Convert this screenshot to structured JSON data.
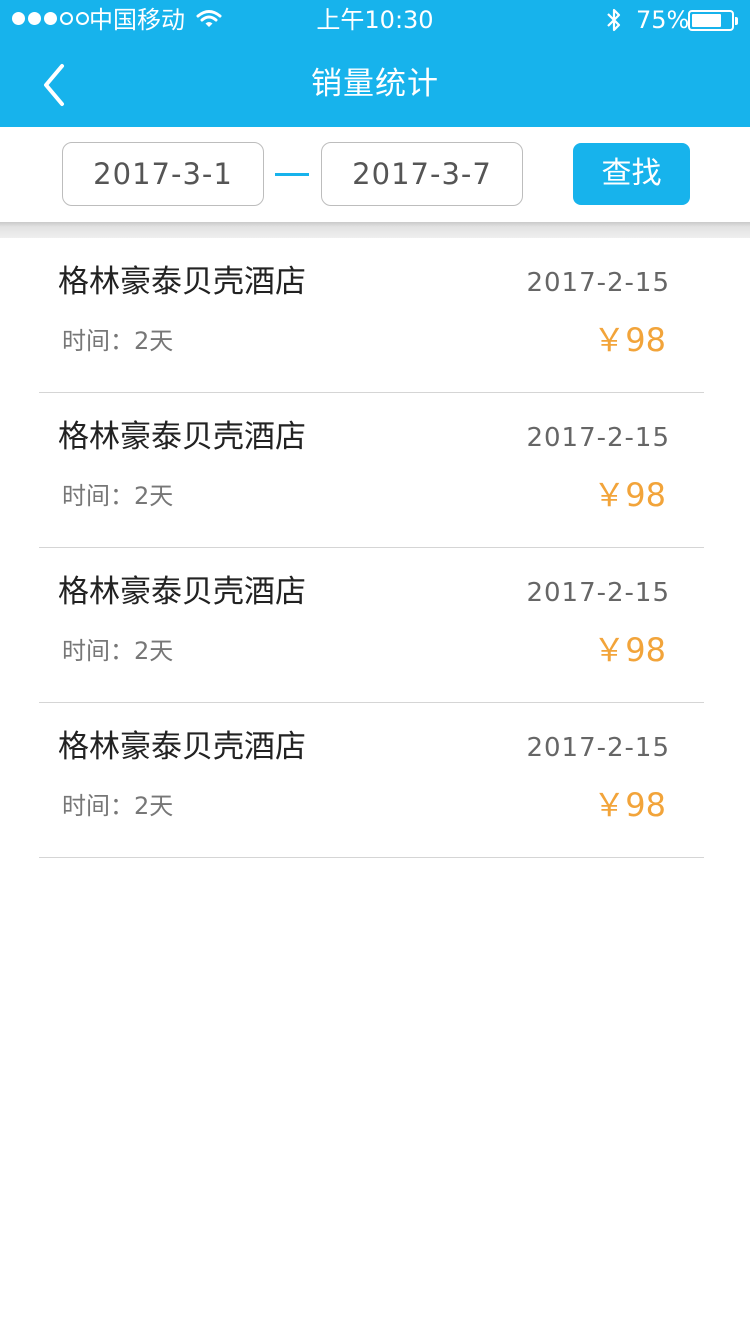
{
  "status_bar": {
    "carrier": "中国移动",
    "time": "上午10:30",
    "battery": "75%",
    "battery_level": 0.75
  },
  "nav": {
    "title": "销量统计"
  },
  "filter": {
    "start_date": "2017-3-1",
    "end_date": "2017-3-7",
    "search_label": "查找"
  },
  "colors": {
    "primary": "#17b3ec",
    "price": "#f2a43a"
  },
  "items": [
    {
      "name": "格林豪泰贝壳酒店",
      "date": "2017-2-15",
      "duration": "时间：2天",
      "price": "￥98"
    },
    {
      "name": "格林豪泰贝壳酒店",
      "date": "2017-2-15",
      "duration": "时间：2天",
      "price": "￥98"
    },
    {
      "name": "格林豪泰贝壳酒店",
      "date": "2017-2-15",
      "duration": "时间：2天",
      "price": "￥98"
    },
    {
      "name": "格林豪泰贝壳酒店",
      "date": "2017-2-15",
      "duration": "时间：2天",
      "price": "￥98"
    }
  ]
}
